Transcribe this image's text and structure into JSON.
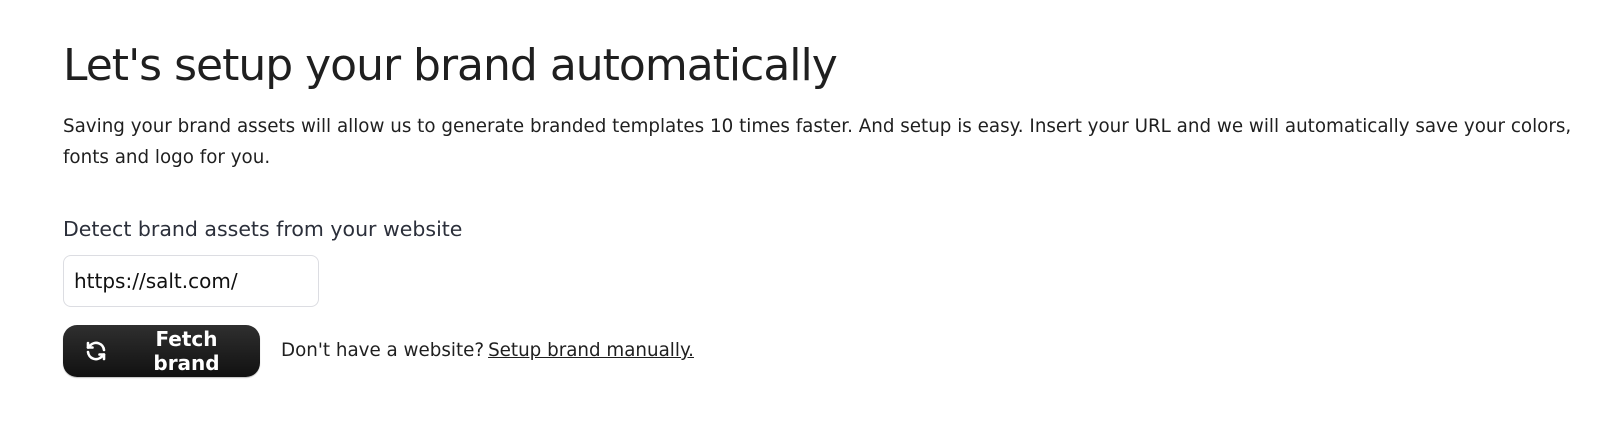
{
  "heading": {
    "title": "Let's setup your brand automatically",
    "description": "Saving your brand assets will allow us to generate branded templates 10 times faster. And setup is easy. Insert your URL and we will automatically save your colors, fonts and logo for you."
  },
  "detect": {
    "label": "Detect brand assets from your website",
    "url_value": "https://salt.com/"
  },
  "actions": {
    "fetch_label": "Fetch brand",
    "fetch_icon": "refresh-icon",
    "no_website_text": "Don't have a website?",
    "manual_link": "Setup brand manually."
  },
  "colors": {
    "primary_button": "#1f1f1f",
    "text": "#1f1f1f",
    "input_border": "#dcdde2"
  }
}
